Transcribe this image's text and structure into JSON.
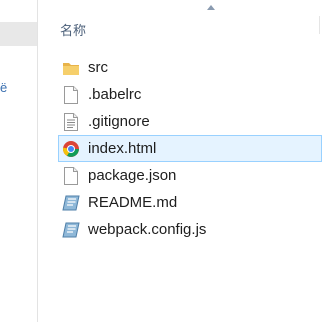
{
  "header": {
    "name_column": "名称"
  },
  "files": [
    {
      "name": "src",
      "icon": "folder-icon"
    },
    {
      "name": ".babelrc",
      "icon": "file-icon"
    },
    {
      "name": ".gitignore",
      "icon": "text-file-icon"
    },
    {
      "name": "index.html",
      "icon": "chrome-html-icon",
      "selected": true
    },
    {
      "name": "package.json",
      "icon": "file-icon"
    },
    {
      "name": "README.md",
      "icon": "markdown-file-icon"
    },
    {
      "name": "webpack.config.js",
      "icon": "script-file-icon"
    }
  ],
  "nav": {
    "partial_glyph": "ё"
  },
  "colors": {
    "selection_bg": "#e5f3ff",
    "selection_border": "#99d1ff",
    "header_text": "#4c607a"
  }
}
